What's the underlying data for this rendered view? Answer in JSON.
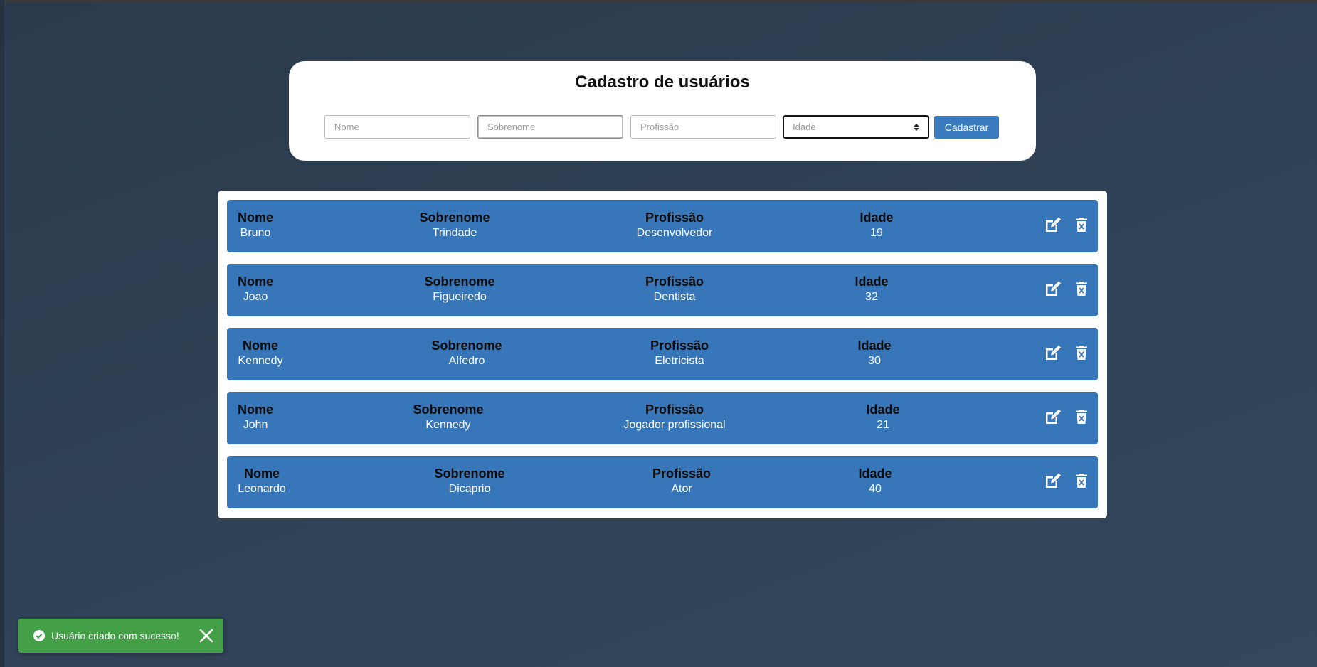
{
  "form": {
    "title": "Cadastro de usuários",
    "nome_placeholder": "Nome",
    "sobrenome_placeholder": "Sobrenome",
    "profissao_placeholder": "Profissão",
    "idade_placeholder": "Idade",
    "submit_label": "Cadastrar"
  },
  "labels": {
    "nome": "Nome",
    "sobrenome": "Sobrenome",
    "profissao": "Profissão",
    "idade": "Idade"
  },
  "users": [
    {
      "nome": "Bruno",
      "sobrenome": "Trindade",
      "profissao": "Desenvolvedor",
      "idade": "19"
    },
    {
      "nome": "Joao",
      "sobrenome": "Figueiredo",
      "profissao": "Dentista",
      "idade": "32"
    },
    {
      "nome": "Kennedy",
      "sobrenome": "Alfedro",
      "profissao": "Eletricista",
      "idade": "30"
    },
    {
      "nome": "John",
      "sobrenome": "Kennedy",
      "profissao": "Jogador profissional",
      "idade": "21"
    },
    {
      "nome": "Leonardo",
      "sobrenome": "Dicaprio",
      "profissao": "Ator",
      "idade": "40"
    }
  ],
  "row_icons": {
    "edit": "edit-icon",
    "delete": "trash-icon"
  },
  "toast": {
    "message": "Usuário criado com sucesso!",
    "icon": "check-circle-icon",
    "close_icon": "close-icon",
    "color": "#43a047"
  },
  "colors": {
    "accent": "#3a7bbf",
    "row_background": "#3777b9"
  }
}
